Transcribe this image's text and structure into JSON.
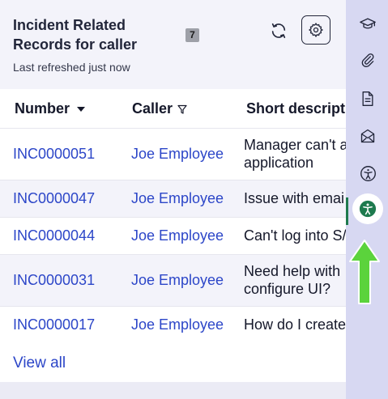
{
  "header": {
    "title": "Incident Related Records for caller",
    "count": "7",
    "refreshed": "Last refreshed just now"
  },
  "table": {
    "columns": {
      "number": "Number",
      "caller": "Caller",
      "description": "Short descriptio"
    },
    "rows": [
      {
        "number": "INC0000051",
        "caller": "Joe Employee",
        "desc1": "Manager can't a",
        "desc2": "application"
      },
      {
        "number": "INC0000047",
        "caller": "Joe Employee",
        "desc1": "Issue with emai",
        "desc2": ""
      },
      {
        "number": "INC0000044",
        "caller": "Joe Employee",
        "desc1": "Can't log into S/",
        "desc2": ""
      },
      {
        "number": "INC0000031",
        "caller": "Joe Employee",
        "desc1": "Need help with",
        "desc2": "configure UI?"
      },
      {
        "number": "INC0000017",
        "caller": "Joe Employee",
        "desc1": "How do I create",
        "desc2": ""
      }
    ]
  },
  "footer": {
    "view_all": "View all"
  },
  "rail": {
    "icons": [
      "graduation-cap-icon",
      "paperclip-icon",
      "document-icon",
      "envelope-icon",
      "accessibility-icon",
      "accessibility-active-icon"
    ],
    "active_color": "#1e7a4e"
  },
  "annotation": {
    "arrow_color": "#5bd33c"
  }
}
